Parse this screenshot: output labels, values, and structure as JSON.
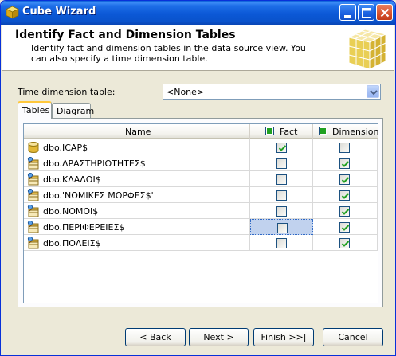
{
  "window": {
    "title": "Cube Wizard",
    "controls": [
      "minimize",
      "maximize",
      "close"
    ]
  },
  "header": {
    "title": "Identify Fact and Dimension Tables",
    "description": "Identify fact and dimension tables in the data source view. You can also specify a time dimension table."
  },
  "time_dimension": {
    "label": "Time dimension table:",
    "selected": "<None>"
  },
  "tabs": [
    {
      "label": "Tables",
      "active": true
    },
    {
      "label": "Diagram",
      "active": false
    }
  ],
  "grid": {
    "columns": {
      "name": "Name",
      "fact": "Fact",
      "dimension": "Dimension"
    },
    "rows": [
      {
        "name": "dbo.ICAP$",
        "icon": "fact-table-icon",
        "fact": true,
        "dimension": false
      },
      {
        "name": "dbo.ΔΡΑΣΤΗΡΙΟΤΗΤΕΣ$",
        "icon": "dimension-table-icon",
        "fact": false,
        "dimension": true
      },
      {
        "name": "dbo.ΚΛΑΔΟΙ$",
        "icon": "dimension-table-icon",
        "fact": false,
        "dimension": true
      },
      {
        "name": "dbo.'ΝΟΜΙΚΕΣ ΜΟΡΦΕΣ$'",
        "icon": "dimension-table-icon",
        "fact": false,
        "dimension": true
      },
      {
        "name": "dbo.ΝΟΜΟΙ$",
        "icon": "dimension-table-icon",
        "fact": false,
        "dimension": true
      },
      {
        "name": "dbo.ΠΕΡΙΦΕΡΕΙΕΣ$",
        "icon": "dimension-table-icon",
        "fact": false,
        "dimension": true
      },
      {
        "name": "dbo.ΠΟΛΕΙΣ$",
        "icon": "dimension-table-icon",
        "fact": false,
        "dimension": true
      }
    ]
  },
  "buttons": {
    "back": "< Back",
    "next": "Next >",
    "finish": "Finish >>|",
    "cancel": "Cancel"
  },
  "colors": {
    "titlebar": "#0b58d6",
    "check": "#21a121",
    "selection": "#c1d2ee",
    "cube_gold": "#e8c63a"
  }
}
